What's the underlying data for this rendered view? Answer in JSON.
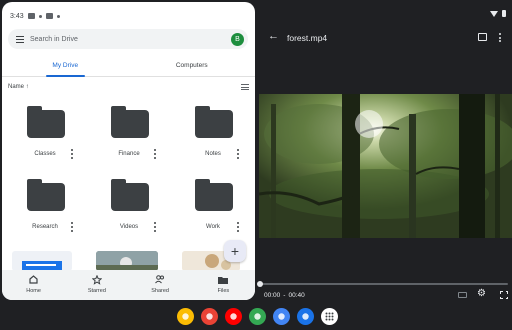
{
  "status_left": {
    "time": "3:43"
  },
  "drive": {
    "search_placeholder": "Search in Drive",
    "avatar_initial": "B",
    "tabs": [
      {
        "label": "My Drive",
        "active": true
      },
      {
        "label": "Computers",
        "active": false
      }
    ],
    "sort_label": "Name",
    "sort_arrow": "↑",
    "folders": [
      {
        "name": "Classes"
      },
      {
        "name": "Finance"
      },
      {
        "name": "Notes"
      },
      {
        "name": "Research"
      },
      {
        "name": "Videos"
      },
      {
        "name": "Work"
      }
    ],
    "fab_label": "+",
    "bottom_nav": [
      {
        "label": "Home",
        "icon": "home-icon"
      },
      {
        "label": "Starred",
        "icon": "star-icon"
      },
      {
        "label": "Shared",
        "icon": "people-icon"
      },
      {
        "label": "Files",
        "icon": "folder-icon"
      }
    ]
  },
  "player": {
    "title": "forest.mp4",
    "current_time": "00:00",
    "separator": "-",
    "duration": "00:40",
    "progress": 0.0
  },
  "shelf": {
    "apps": [
      {
        "name": "chrome-icon",
        "color": "#fbbc04"
      },
      {
        "name": "chrome-browser-icon",
        "color": "#ea4335"
      },
      {
        "name": "youtube-icon",
        "color": "#ff0000"
      },
      {
        "name": "photos-icon",
        "color": "#34a853"
      },
      {
        "name": "files-icon",
        "color": "#4285f4"
      },
      {
        "name": "meet-icon",
        "color": "#1a73e8"
      },
      {
        "name": "launcher-icon",
        "color": "#ffffff"
      }
    ]
  },
  "colors": {
    "accent": "#1967d2",
    "avatar": "#1e8e3e",
    "dark_bg": "#1f2023"
  }
}
